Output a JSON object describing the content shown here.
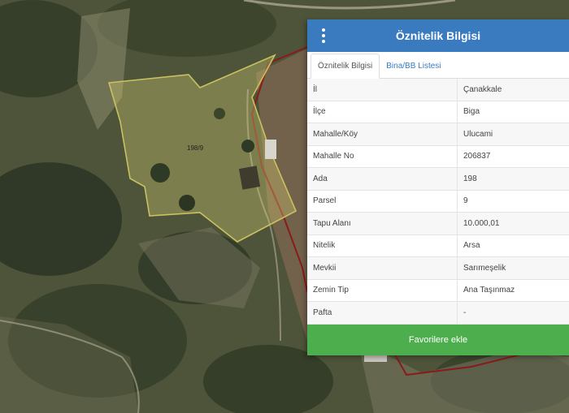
{
  "map": {
    "parcel_label": "198/9",
    "parcel_outline_color": "#c9c25e",
    "neighbor_outline_color": "#8b1a1a"
  },
  "panel": {
    "title": "Öznitelik Bilgisi",
    "menu_icon": "vertical-ellipsis-icon",
    "accent_color": "#3a7bbf",
    "tabs": [
      {
        "label": "Öznitelik Bilgisi",
        "active": true
      },
      {
        "label": "Bina/BB Listesi",
        "active": false
      }
    ],
    "rows": [
      {
        "key": "İl",
        "value": "Çanakkale"
      },
      {
        "key": "İlçe",
        "value": "Biga"
      },
      {
        "key": "Mahalle/Köy",
        "value": "Ulucami"
      },
      {
        "key": "Mahalle No",
        "value": "206837"
      },
      {
        "key": "Ada",
        "value": "198"
      },
      {
        "key": "Parsel",
        "value": "9"
      },
      {
        "key": "Tapu Alanı",
        "value": "10.000,01"
      },
      {
        "key": "Nitelik",
        "value": "Arsa"
      },
      {
        "key": "Mevkii",
        "value": "Sarımeşelik"
      },
      {
        "key": "Zemin Tip",
        "value": "Ana Taşınmaz"
      },
      {
        "key": "Pafta",
        "value": "-"
      }
    ],
    "favorite_button": "Favorilere ekle",
    "favorite_color": "#4cae4c"
  }
}
